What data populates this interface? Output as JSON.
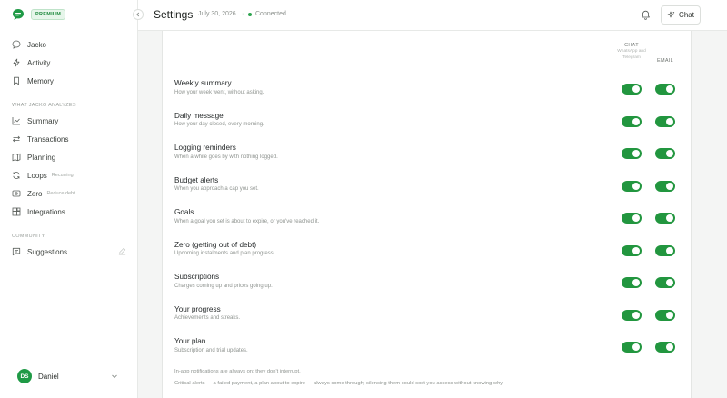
{
  "brand": {
    "badge": "PREMIUM"
  },
  "sidebar": {
    "top_items": [
      {
        "label": "Jacko",
        "sub": ""
      },
      {
        "label": "Activity",
        "sub": ""
      },
      {
        "label": "Memory",
        "sub": ""
      }
    ],
    "analyzes_label": "WHAT JACKO ANALYZES",
    "analyze_items": [
      {
        "label": "Summary",
        "sub": ""
      },
      {
        "label": "Transactions",
        "sub": ""
      },
      {
        "label": "Planning",
        "sub": ""
      },
      {
        "label": "Loops",
        "sub": "Recurring"
      },
      {
        "label": "Zero",
        "sub": "Reduce debt"
      },
      {
        "label": "Integrations",
        "sub": ""
      }
    ],
    "community_label": "COMMUNITY",
    "community_items": [
      {
        "label": "Suggestions",
        "sub": ""
      }
    ],
    "user": {
      "initials": "DS",
      "name": "Daniel"
    }
  },
  "header": {
    "title": "Settings",
    "date": "July 30, 2026",
    "separator": "·",
    "status": "Connected",
    "chat_label": "Chat"
  },
  "columns": {
    "chat": {
      "label": "CHAT",
      "sub": "WhatsApp and Telegram"
    },
    "email": {
      "label": "EMAIL"
    }
  },
  "notifications": [
    {
      "title": "Weekly summary",
      "desc": "How your week went, without asking.",
      "chat": true,
      "email": true
    },
    {
      "title": "Daily message",
      "desc": "How your day closed, every morning.",
      "chat": true,
      "email": true
    },
    {
      "title": "Logging reminders",
      "desc": "When a while goes by with nothing logged.",
      "chat": true,
      "email": true
    },
    {
      "title": "Budget alerts",
      "desc": "When you approach a cap you set.",
      "chat": true,
      "email": true
    },
    {
      "title": "Goals",
      "desc": "When a goal you set is about to expire, or you've reached it.",
      "chat": true,
      "email": true
    },
    {
      "title": "Zero (getting out of debt)",
      "desc": "Upcoming instalments and plan progress.",
      "chat": true,
      "email": true
    },
    {
      "title": "Subscriptions",
      "desc": "Charges coming up and prices going up.",
      "chat": true,
      "email": true
    },
    {
      "title": "Your progress",
      "desc": "Achievements and streaks.",
      "chat": true,
      "email": true
    },
    {
      "title": "Your plan",
      "desc": "Subscription and trial updates.",
      "chat": true,
      "email": true
    }
  ],
  "footnotes": [
    "In-app notifications are always on; they don't interrupt.",
    "Critical alerts — a failed payment, a plan about to expire — always come through; silencing them could cost you access without knowing why."
  ],
  "colors": {
    "accent": "#22963f",
    "status": "#2ea44f"
  }
}
